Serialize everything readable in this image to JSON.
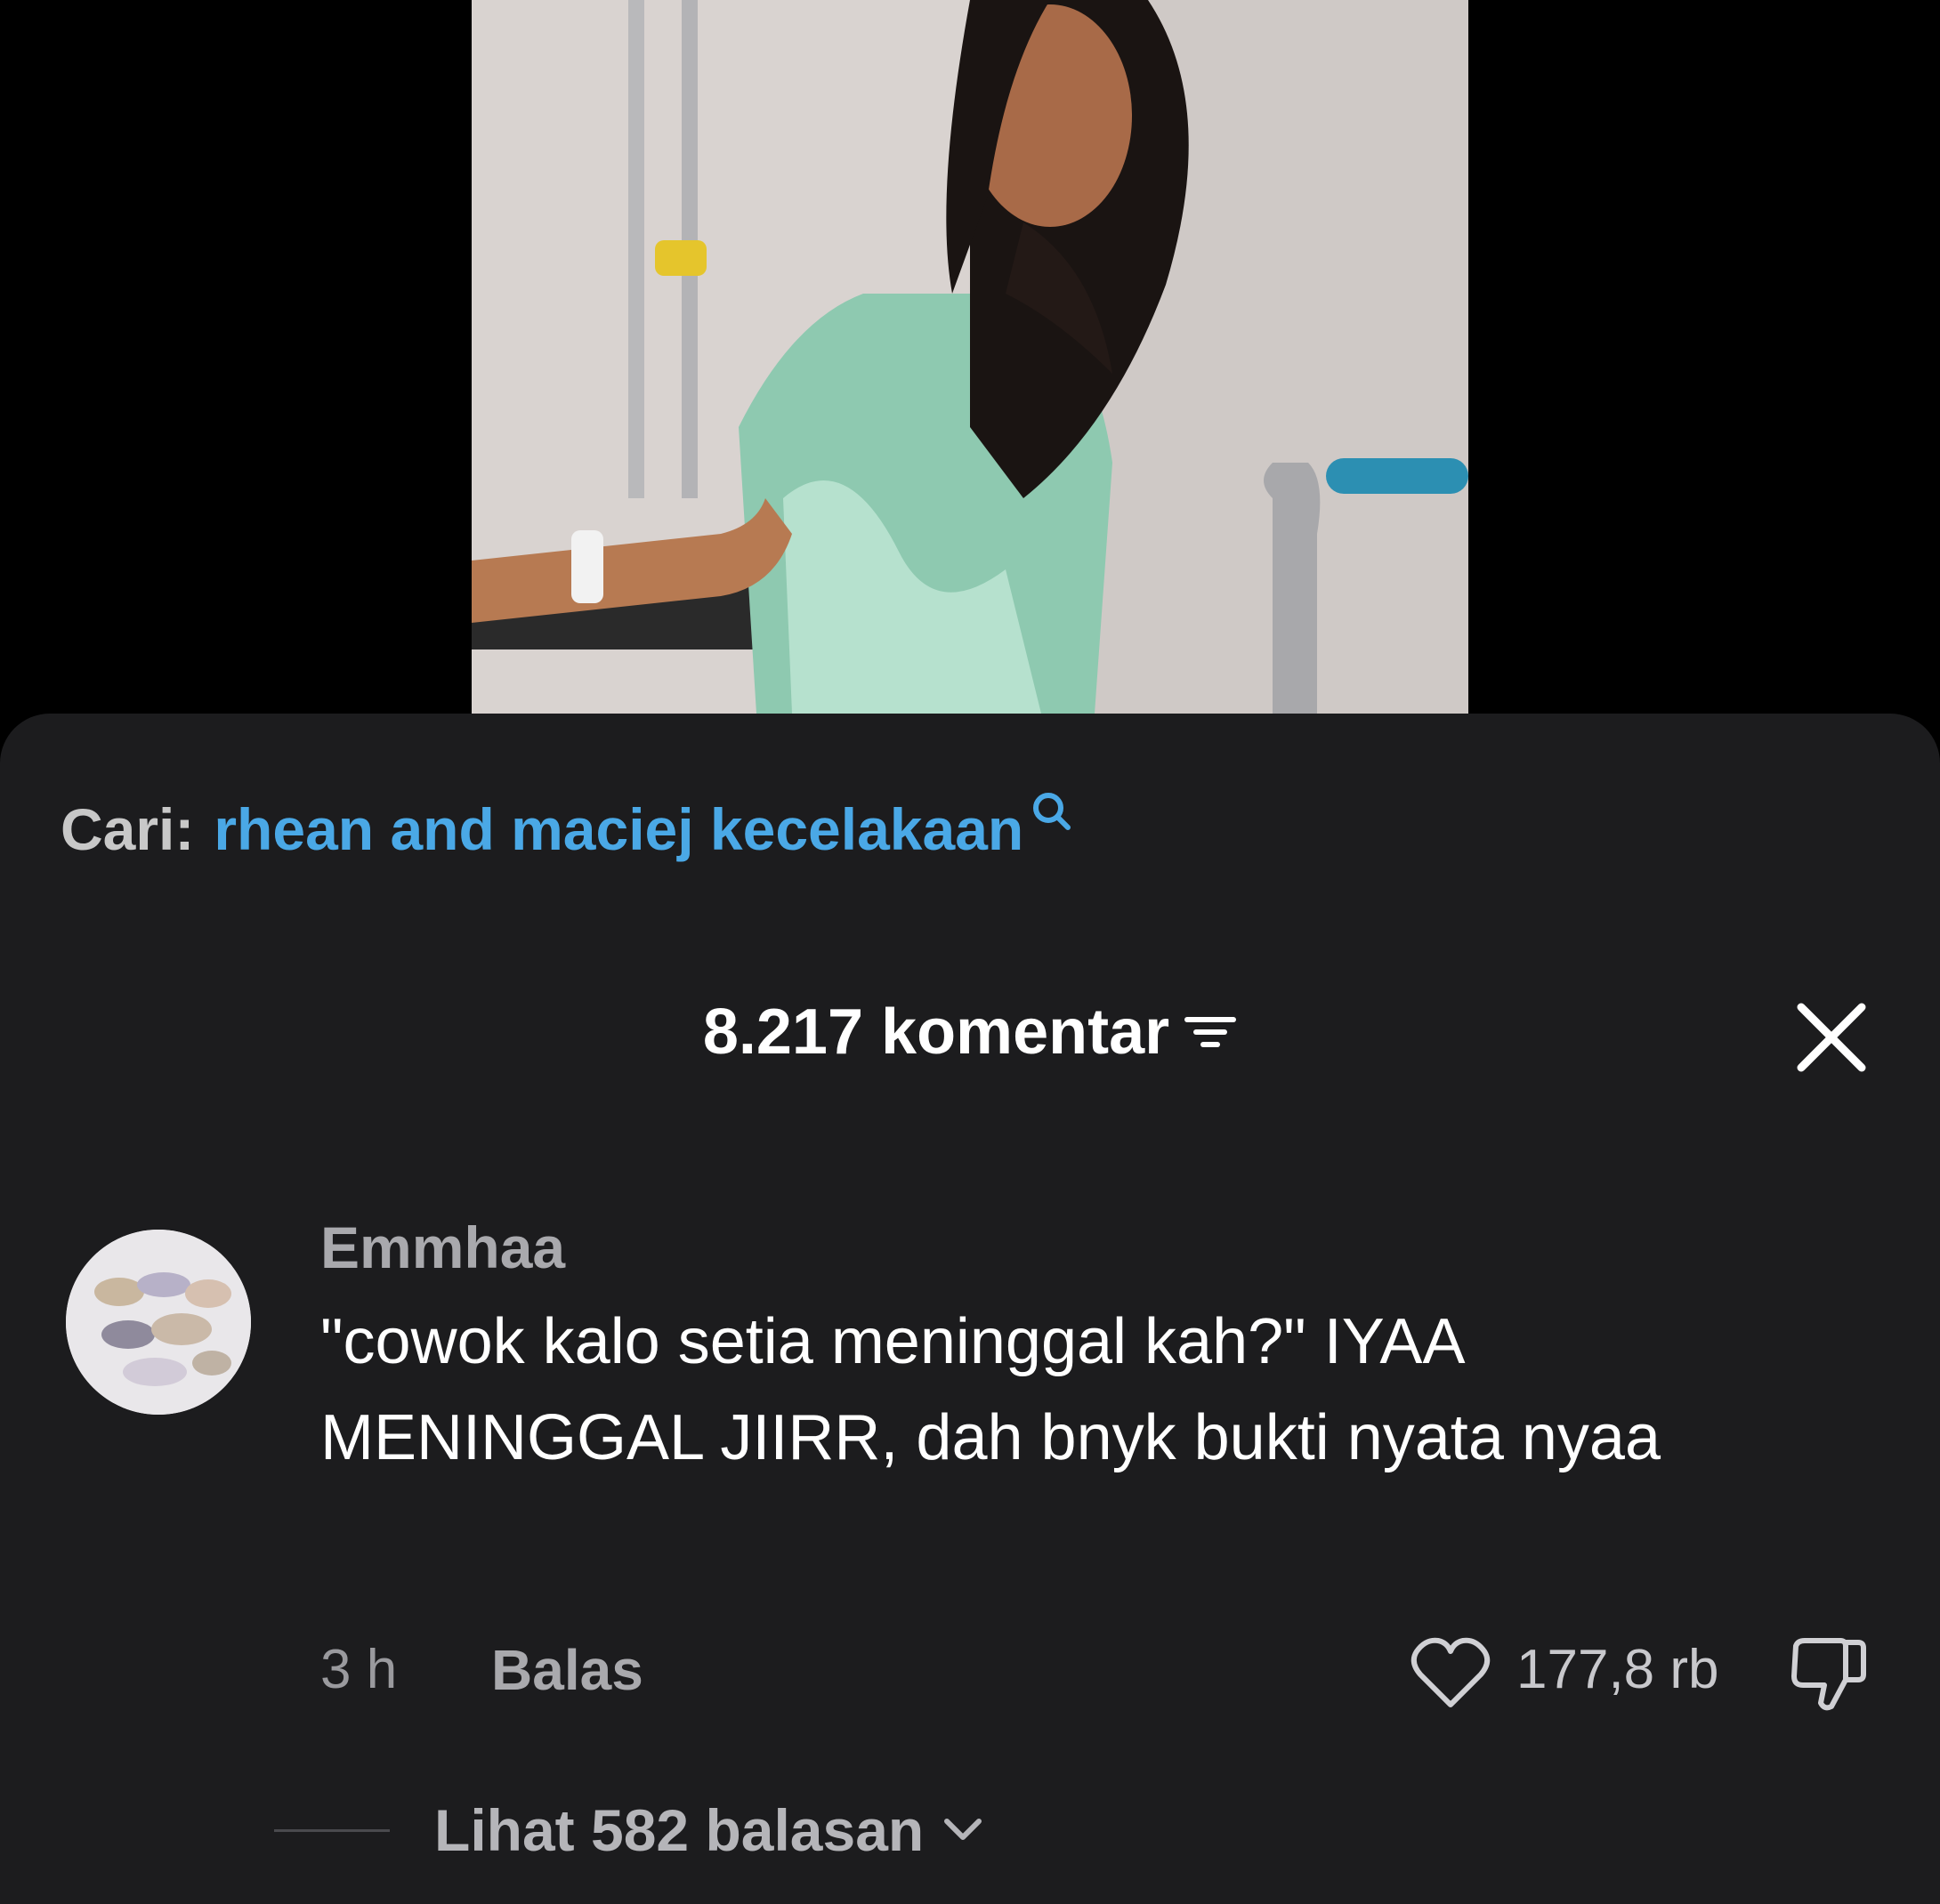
{
  "search": {
    "prefix": "Cari:",
    "query": "rhean and maciej kecelakaan"
  },
  "header": {
    "comment_count": "8.217 komentar"
  },
  "comment": {
    "username": "Emmhaa",
    "text": "\"cowok kalo setia meninggal kah?\" IYAA MENINGGAL JIIRR, dah bnyk bukti nyata nyaa",
    "timestamp": "3 h",
    "reply_label": "Balas",
    "like_count": "177,8 rb",
    "replies_label": "Lihat 582 balasan"
  },
  "colors": {
    "sheet_background": "#1c1c1e",
    "search_query": "#4aa8e6",
    "muted_text": "#a9a9ad"
  },
  "icons": {
    "search": "search-icon",
    "filter": "filter-icon",
    "close": "close-icon",
    "like": "heart-icon",
    "dislike": "thumbs-down-icon",
    "expand": "chevron-down-icon"
  }
}
